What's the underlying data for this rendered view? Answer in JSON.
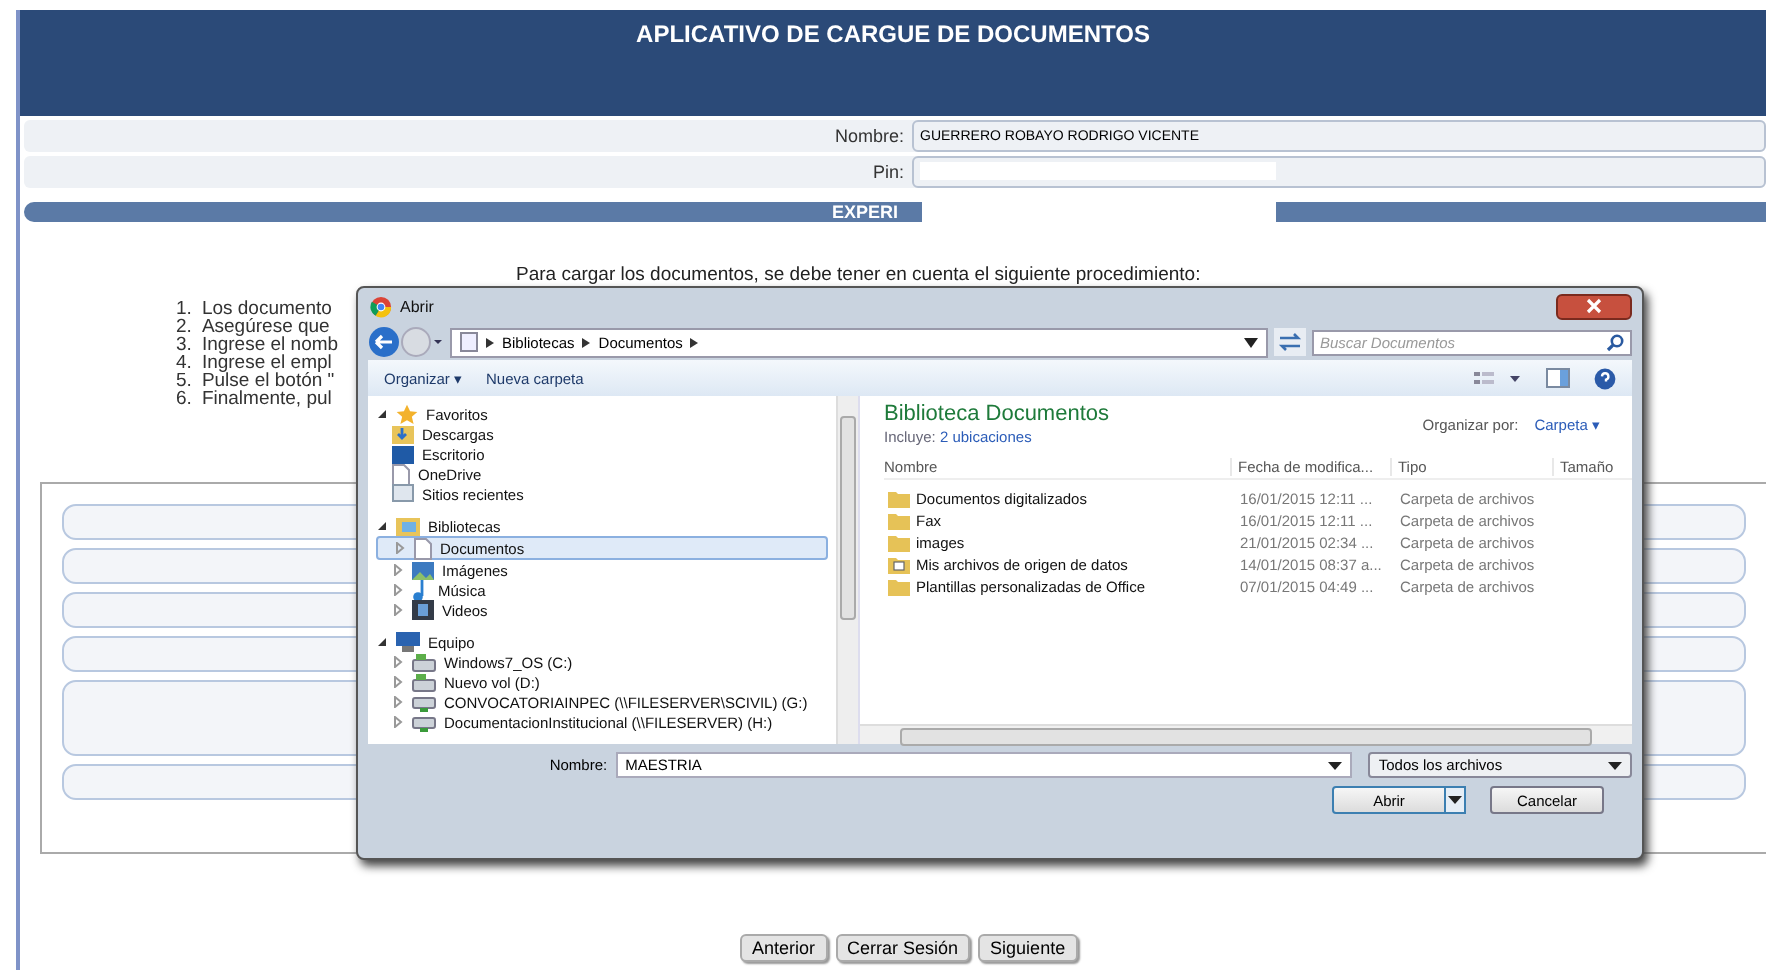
{
  "header": {
    "title": "APLICATIVO DE CARGUE DE DOCUMENTOS"
  },
  "form": [
    {
      "label": "Nombre:",
      "value": "GUERRERO ROBAYO RODRIGO VICENTE"
    },
    {
      "label": "Pin:"
    }
  ],
  "section_bar": {
    "title": "EXPERI"
  },
  "intro": "Para cargar los documentos, se debe tener en cuenta el siguiente procedimiento:",
  "steps": [
    {
      "number": "1.",
      "text": "Los documento"
    },
    {
      "number": "2.",
      "text": "Asegúrese que"
    },
    {
      "number": "3.",
      "text": "Ingrese el nomb"
    },
    {
      "number": "4.",
      "text": "Ingrese el empl"
    },
    {
      "number": "5.",
      "text": "Pulse el botón \""
    },
    {
      "number": "6.",
      "text": "Finalmente, pul"
    }
  ],
  "upload_rows": [
    {
      "tall": false
    },
    {
      "tall": false
    },
    {
      "tall": false
    },
    {
      "tall": false
    },
    {
      "tall": true
    },
    {
      "tall": false
    }
  ],
  "buttons": [
    "Anterior",
    "Cerrar Sesión",
    "Siguiente"
  ],
  "dialog": {
    "title": "Abrir",
    "path": [
      "Bibliotecas",
      "Documentos"
    ],
    "search_placeholder": "Buscar Documentos",
    "toolbar": [
      "Organizar ▾",
      "Nueva carpeta"
    ],
    "nav": [
      {
        "label": "Favoritos",
        "kind": "star",
        "expanded": true,
        "children": [
          {
            "label": "Descargas",
            "kind": "download",
            "selected": false
          },
          {
            "label": "Escritorio",
            "kind": "desktop",
            "selected": false
          },
          {
            "label": "OneDrive",
            "kind": "page",
            "selected": false
          },
          {
            "label": "Sitios recientes",
            "kind": "recent",
            "selected": false
          }
        ]
      },
      {
        "label": "Bibliotecas",
        "kind": "library",
        "expanded": true,
        "children": [
          {
            "label": "Documentos",
            "kind": "page",
            "selected": true
          },
          {
            "label": "Imágenes",
            "kind": "image",
            "selected": false
          },
          {
            "label": "Música",
            "kind": "music",
            "selected": false
          },
          {
            "label": "Videos",
            "kind": "video",
            "selected": false
          }
        ]
      },
      {
        "label": "Equipo",
        "kind": "computer",
        "expanded": true,
        "children": [
          {
            "label": "Windows7_OS (C:)",
            "kind": "drive",
            "selected": false
          },
          {
            "label": "Nuevo vol (D:)",
            "kind": "drive",
            "selected": false
          },
          {
            "label": "CONVOCATORIAINPEC (\\\\FILESERVER\\SCIVIL) (G:)",
            "kind": "network",
            "selected": false
          },
          {
            "label": "DocumentacionInstitucional (\\\\FILESERVER) (H:)",
            "kind": "network",
            "selected": false
          }
        ]
      }
    ],
    "library_title": "Biblioteca Documentos",
    "includes_label": "Incluye:",
    "includes_link": "2 ubicaciones",
    "arrange_label": "Organizar por:",
    "arrange_value": "Carpeta ▾",
    "columns": [
      "Nombre",
      "Fecha de modifica...",
      "Tipo",
      "Tamaño"
    ],
    "files": [
      {
        "name": "Documentos digitalizados",
        "date": "16/01/2015 12:11 ...",
        "type": "Carpeta de archivos",
        "kind": "folder"
      },
      {
        "name": "Fax",
        "date": "16/01/2015 12:11 ...",
        "type": "Carpeta de archivos",
        "kind": "folder"
      },
      {
        "name": "images",
        "date": "21/01/2015 02:34 ...",
        "type": "Carpeta de archivos",
        "kind": "folder"
      },
      {
        "name": "Mis archivos de origen de datos",
        "date": "14/01/2015 08:37 a...",
        "type": "Carpeta de archivos",
        "kind": "datasource"
      },
      {
        "name": "Plantillas personalizadas de Office",
        "date": "07/01/2015 04:49 ...",
        "type": "Carpeta de archivos",
        "kind": "folder"
      }
    ],
    "filename_label": "Nombre:",
    "filename": "MAESTRIA",
    "filter": "Todos los archivos",
    "open_button": "Abrir",
    "cancel_button": "Cancelar"
  }
}
